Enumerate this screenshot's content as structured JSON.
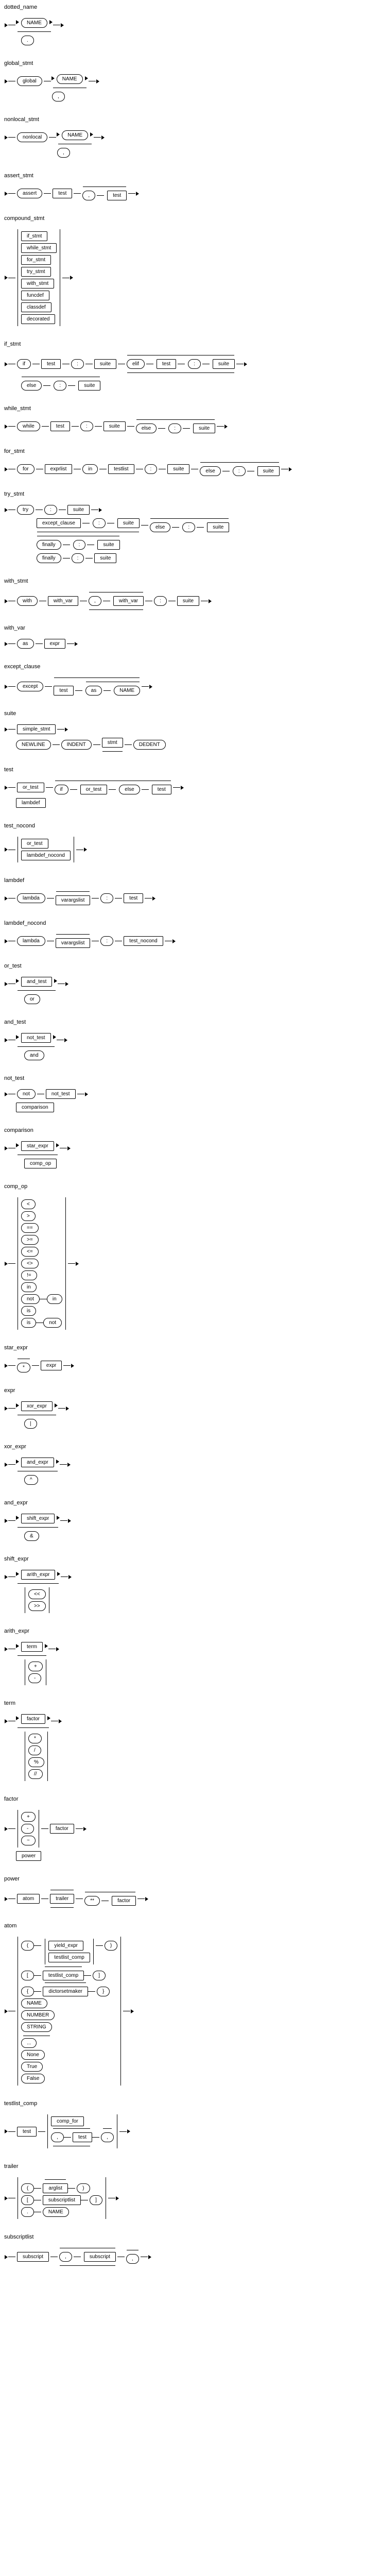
{
  "rules": {
    "dotted_name": {
      "title": "dotted_name",
      "items": [
        "NAME",
        "."
      ]
    },
    "global_stmt": {
      "title": "global_stmt",
      "items": [
        "global",
        "NAME",
        ","
      ]
    },
    "nonlocal_stmt": {
      "title": "nonlocal_stmt",
      "items": [
        "nonlocal",
        "NAME",
        ","
      ]
    },
    "assert_stmt": {
      "title": "assert_stmt",
      "items": [
        "assert",
        "test",
        ",",
        "test"
      ]
    },
    "compound_stmt": {
      "title": "compound_stmt",
      "alts": [
        "if_stmt",
        "while_stmt",
        "for_stmt",
        "try_stmt",
        "with_stmt",
        "funcdef",
        "classdef",
        "decorated"
      ]
    },
    "if_stmt": {
      "title": "if_stmt",
      "items": [
        "if",
        "test",
        ":",
        "suite",
        "elif",
        "test",
        ":",
        "suite",
        "else",
        ":",
        "suite"
      ]
    },
    "while_stmt": {
      "title": "while_stmt",
      "items": [
        "while",
        "test",
        ":",
        "suite",
        "else",
        ":",
        "suite"
      ]
    },
    "for_stmt": {
      "title": "for_stmt",
      "items": [
        "for",
        "exprlist",
        "in",
        "testlist",
        ":",
        "suite",
        "else",
        ":",
        "suite"
      ]
    },
    "try_stmt": {
      "title": "try_stmt",
      "items": [
        "try",
        ":",
        "suite",
        "except_clause",
        ":",
        "suite",
        "else",
        ":",
        "suite",
        "finally",
        ":",
        "suite",
        "finally",
        ":",
        "suite"
      ]
    },
    "with_stmt": {
      "title": "with_stmt",
      "items": [
        "with",
        "with_var",
        ",",
        "with_var",
        ":",
        "suite"
      ]
    },
    "with_var": {
      "title": "with_var",
      "items": [
        "as",
        "expr"
      ]
    },
    "except_clause": {
      "title": "except_clause",
      "items": [
        "except",
        "test",
        "as",
        "NAME"
      ]
    },
    "suite": {
      "title": "suite",
      "alts": [
        "simple_stmt"
      ],
      "items": [
        "NEWLINE",
        "INDENT",
        "stmt",
        "DEDENT"
      ]
    },
    "test": {
      "title": "test",
      "items": [
        "or_test",
        "if",
        "or_test",
        "else",
        "test"
      ],
      "alts": [
        "lambdef"
      ]
    },
    "test_nocond": {
      "title": "test_nocond",
      "alts": [
        "or_test",
        "lambdef_nocond"
      ]
    },
    "lambdef": {
      "title": "lambdef",
      "items": [
        "lambda",
        "varargslist",
        ":",
        "test"
      ]
    },
    "lambdef_nocond": {
      "title": "lambdef_nocond",
      "items": [
        "lambda",
        "varargslist",
        ":",
        "test_nocond"
      ]
    },
    "or_test": {
      "title": "or_test",
      "items": [
        "and_test",
        "or"
      ]
    },
    "and_test": {
      "title": "and_test",
      "items": [
        "not_test",
        "and"
      ]
    },
    "not_test": {
      "title": "not_test",
      "items": [
        "not",
        "not_test"
      ],
      "alts": [
        "comparison"
      ]
    },
    "comparison": {
      "title": "comparison",
      "items": [
        "star_expr",
        "comp_op"
      ]
    },
    "comp_op": {
      "title": "comp_op",
      "alts": [
        "<",
        ">",
        "==",
        ">=",
        "<=",
        "<>",
        "!=",
        "in",
        "not in",
        "is",
        "is not"
      ],
      "items": [
        "not",
        "in",
        "is",
        "not"
      ]
    },
    "star_expr": {
      "title": "star_expr",
      "items": [
        "*",
        "expr"
      ]
    },
    "expr": {
      "title": "expr",
      "items": [
        "xor_expr",
        "|"
      ]
    },
    "xor_expr": {
      "title": "xor_expr",
      "items": [
        "and_expr",
        "^"
      ]
    },
    "and_expr": {
      "title": "and_expr",
      "items": [
        "shift_expr",
        "&"
      ]
    },
    "shift_expr": {
      "title": "shift_expr",
      "items": [
        "arith_expr",
        "<<",
        ">>"
      ]
    },
    "arith_expr": {
      "title": "arith_expr",
      "items": [
        "term",
        "+",
        "-"
      ]
    },
    "term": {
      "title": "term",
      "items": [
        "factor",
        "*",
        "/",
        "%",
        "//"
      ]
    },
    "factor": {
      "title": "factor",
      "items": [
        "+",
        "-",
        "~",
        "factor"
      ],
      "alts": [
        "power"
      ]
    },
    "power": {
      "title": "power",
      "items": [
        "atom",
        "trailer",
        "**",
        "factor"
      ]
    },
    "atom": {
      "title": "atom",
      "items": [
        "(",
        "yield_expr",
        "testlist_comp",
        ")",
        "[",
        "testlist_comp",
        "]",
        "{",
        "dictorsetmaker",
        "}",
        "NAME",
        "NUMBER",
        "STRING",
        "...",
        "None",
        "True",
        "False"
      ]
    },
    "testlist_comp": {
      "title": "testlist_comp",
      "items": [
        "test",
        "comp_for",
        ",",
        "test",
        ","
      ]
    },
    "trailer": {
      "title": "trailer",
      "items": [
        "(",
        "arglist",
        ")",
        "[",
        "subscriptlist",
        "]",
        ".",
        "NAME"
      ]
    },
    "subscriptlist": {
      "title": "subscriptlist",
      "items": [
        "subscript",
        ",",
        "subscript",
        ","
      ]
    }
  }
}
